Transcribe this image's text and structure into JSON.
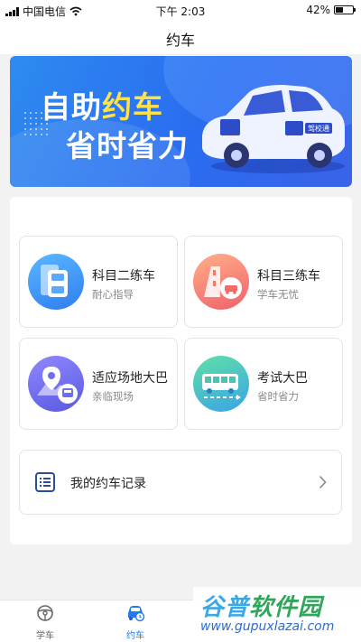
{
  "status_bar": {
    "carrier": "中国电信",
    "time": "下午 2:03",
    "battery_text": "42%",
    "battery_level": 0.42
  },
  "nav": {
    "title": "约车"
  },
  "banner": {
    "line1_pre": "自助",
    "line1_highlight": "约车",
    "line2": "省时省力",
    "car_brand": "驾校通",
    "accent_yellow": "#ffe24a"
  },
  "services": [
    {
      "title": "科目二练车",
      "subtitle": "耐心指导",
      "icon": "practice-car-icon"
    },
    {
      "title": "科目三练车",
      "subtitle": "学车无忧",
      "icon": "road-car-icon"
    },
    {
      "title": "适应场地大巴",
      "subtitle": "亲临现场",
      "icon": "location-bus-icon"
    },
    {
      "title": "考试大巴",
      "subtitle": "省时省力",
      "icon": "bus-icon"
    }
  ],
  "record": {
    "label": "我的约车记录",
    "icon": "list-icon"
  },
  "tabs": [
    {
      "label": "学车",
      "icon": "steering-wheel-icon",
      "active": false
    },
    {
      "label": "约车",
      "icon": "car-clock-icon",
      "active": true
    }
  ],
  "watermark": {
    "title_a": "谷普",
    "title_b": "软件园",
    "url": "www.gupuxlazai.com"
  },
  "colors": {
    "accent": "#1f7cf2",
    "background": "#f2f2f2"
  }
}
